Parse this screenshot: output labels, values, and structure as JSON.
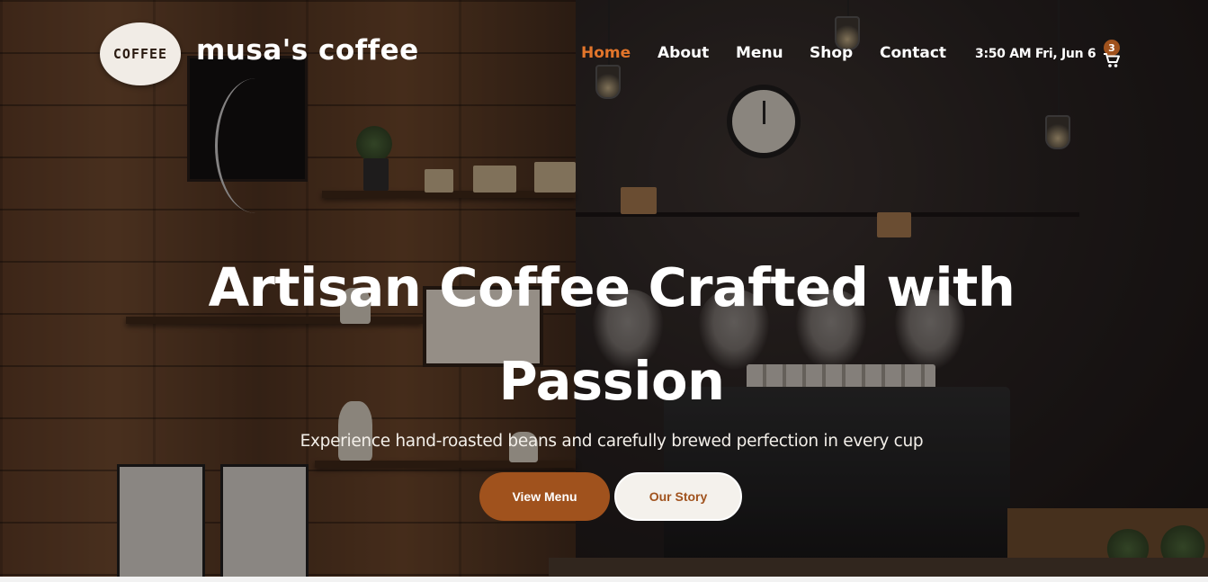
{
  "header": {
    "logo_text": "COFFEE",
    "brand_name": "musa's coffee",
    "nav": [
      {
        "label": "Home",
        "active": true
      },
      {
        "label": "About",
        "active": false
      },
      {
        "label": "Menu",
        "active": false
      },
      {
        "label": "Shop",
        "active": false
      },
      {
        "label": "Contact",
        "active": false
      }
    ],
    "datetime": "3:50 AM Fri, Jun 6",
    "cart_count": "3"
  },
  "hero": {
    "title_line1": "Artisan Coffee Crafted with",
    "title_line2": "Passion",
    "subtitle": "Experience hand-roasted beans and carefully brewed perfection in every cup",
    "primary_button": "View Menu",
    "secondary_button": "Our Story"
  },
  "colors": {
    "accent": "#a0521d",
    "nav_active": "#e2752b",
    "text": "#ffffff"
  },
  "icons": {
    "cart": "shopping-cart-icon"
  }
}
